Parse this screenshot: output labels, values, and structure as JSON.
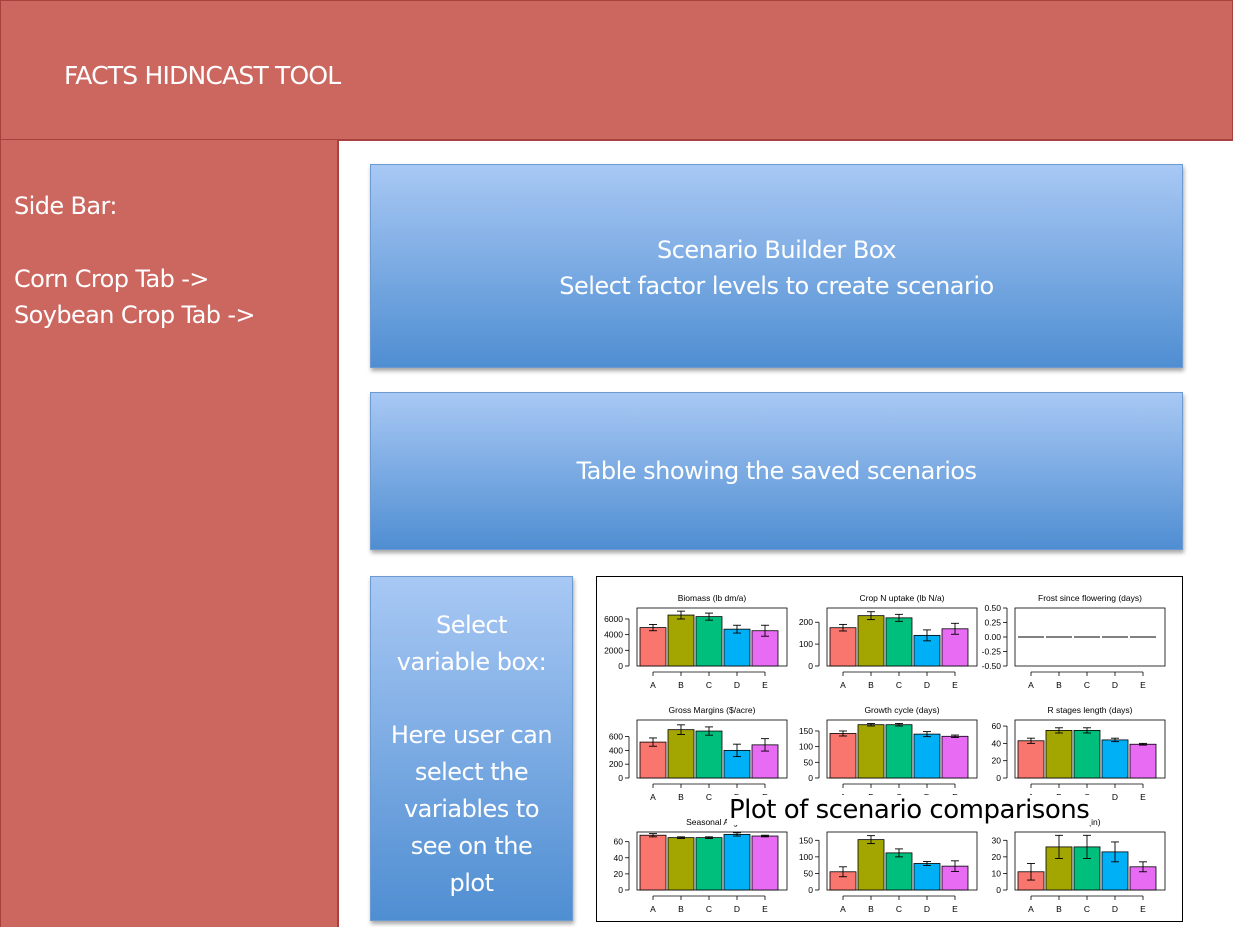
{
  "header": {
    "title": "FACTS HIDNCAST TOOL"
  },
  "sidebar": {
    "heading": "Side Bar:",
    "items": [
      {
        "label": "Corn Crop Tab ->"
      },
      {
        "label": "Soybean Crop Tab ->"
      }
    ]
  },
  "scenario_builder": {
    "title": "Scenario Builder Box",
    "subtitle": "Select factor levels to create scenario"
  },
  "saved_table": {
    "label": "Table showing the saved scenarios"
  },
  "variable_box": {
    "title_line1": "Select",
    "title_line2": "variable box:",
    "desc_lines": [
      "Here user can",
      "select the",
      "variables to",
      "see on the",
      "plot"
    ]
  },
  "plot_caption": "Plot of scenario comparisons",
  "colors": {
    "header_bg": "#cc6760",
    "box_top": "#a8c8f4",
    "box_bottom": "#4f8ed2",
    "bar_colors": [
      "#f8766d",
      "#a3a500",
      "#00bf7d",
      "#00b0f6",
      "#e76bf3"
    ]
  },
  "chart_data": [
    {
      "type": "bar",
      "title": "Biomass (lb dm/a)",
      "categories": [
        "A",
        "B",
        "C",
        "D",
        "E"
      ],
      "values": [
        4900,
        6500,
        6300,
        4700,
        4500
      ],
      "errors": [
        400,
        500,
        450,
        500,
        700
      ],
      "ylim": [
        0,
        7400
      ],
      "yticks": [
        0,
        2000,
        4000,
        6000
      ],
      "ytick_labels": [
        "0",
        "2000",
        "4000",
        "6000"
      ],
      "show_xlabels": true,
      "visible_title": "Biomass (lb dm/a)"
    },
    {
      "type": "bar",
      "title": "Crop N uptake (lb N/a)",
      "categories": [
        "A",
        "B",
        "C",
        "D",
        "E"
      ],
      "values": [
        175,
        230,
        220,
        140,
        170
      ],
      "errors": [
        15,
        18,
        16,
        25,
        25
      ],
      "ylim": [
        0,
        265
      ],
      "yticks": [
        0,
        100,
        200
      ],
      "ytick_labels": [
        "0",
        "100",
        "200"
      ],
      "show_xlabels": true,
      "visible_title": "Crop N uptake (lb N/a)"
    },
    {
      "type": "bar",
      "title": "Frost since flowering (days)",
      "categories": [
        "A",
        "B",
        "C",
        "D",
        "E"
      ],
      "values": [
        0,
        0,
        0,
        0,
        0
      ],
      "errors": [
        0,
        0,
        0,
        0,
        0
      ],
      "ylim": [
        -0.5,
        0.5
      ],
      "yticks": [
        -0.5,
        -0.25,
        0,
        0.25,
        0.5
      ],
      "ytick_labels": [
        "-0.50",
        "-0.25",
        "0.00",
        "0.25",
        "0.50"
      ],
      "show_xlabels": true,
      "visible_title": "Frost since flowering (days)"
    },
    {
      "type": "bar",
      "title": "Gross Margins ($/acre)",
      "categories": [
        "A",
        "B",
        "C",
        "D",
        "E"
      ],
      "values": [
        520,
        700,
        680,
        400,
        480
      ],
      "errors": [
        60,
        70,
        60,
        90,
        90
      ],
      "ylim": [
        0,
        840
      ],
      "yticks": [
        0,
        200,
        400,
        600
      ],
      "ytick_labels": [
        "0",
        "200",
        "400",
        "600"
      ],
      "show_xlabels": true,
      "visible_title": "Gross Margins ($/acre)"
    },
    {
      "type": "bar",
      "title": "Growth cycle (days)",
      "categories": [
        "A",
        "B",
        "C",
        "D",
        "E"
      ],
      "values": [
        142,
        170,
        170,
        140,
        133
      ],
      "errors": [
        8,
        4,
        4,
        8,
        4
      ],
      "ylim": [
        0,
        185
      ],
      "yticks": [
        0,
        50,
        100,
        150
      ],
      "ytick_labels": [
        "0",
        "50",
        "100",
        "150"
      ],
      "show_xlabels": true,
      "visible_title": "Growth cycle (days)"
    },
    {
      "type": "bar",
      "title": "R stages length (days)",
      "categories": [
        "A",
        "B",
        "C",
        "D",
        "E"
      ],
      "values": [
        43,
        55,
        55,
        44,
        39
      ],
      "errors": [
        3,
        3,
        3,
        2,
        1
      ],
      "ylim": [
        0,
        67
      ],
      "yticks": [
        0,
        20,
        40,
        60
      ],
      "ytick_labels": [
        "0",
        "20",
        "40",
        "60"
      ],
      "show_xlabels": true,
      "visible_title": "R stages length (days)"
    },
    {
      "type": "bar",
      "title": "Seasonal Avg",
      "categories": [
        "A",
        "B",
        "C",
        "D",
        "E"
      ],
      "values": [
        68,
        65,
        65,
        69,
        67
      ],
      "errors": [
        2,
        1,
        1,
        2,
        1
      ],
      "ylim": [
        0,
        72
      ],
      "yticks": [
        0,
        20,
        40,
        60
      ],
      "ytick_labels": [
        "0",
        "20",
        "40",
        "60"
      ],
      "show_xlabels": true,
      "visible_title": "Seasonal Avg"
    },
    {
      "type": "bar",
      "title": "",
      "categories": [
        "A",
        "B",
        "C",
        "D",
        "E"
      ],
      "values": [
        55,
        152,
        112,
        80,
        72
      ],
      "errors": [
        15,
        12,
        12,
        6,
        16
      ],
      "ylim": [
        0,
        175
      ],
      "yticks": [
        0,
        50,
        100,
        150
      ],
      "ytick_labels": [
        "0",
        "50",
        "100",
        "150"
      ],
      "show_xlabels": true,
      "visible_title": ""
    },
    {
      "type": "bar",
      "title": "in (in)",
      "categories": [
        "A",
        "B",
        "C",
        "D",
        "E"
      ],
      "values": [
        11,
        26,
        26,
        23,
        14
      ],
      "errors": [
        5,
        7,
        7,
        6,
        3
      ],
      "ylim": [
        0,
        35
      ],
      "yticks": [
        0,
        10,
        20,
        30
      ],
      "ytick_labels": [
        "0",
        "10",
        "20",
        "30"
      ],
      "show_xlabels": true,
      "visible_title": "in (in)"
    }
  ]
}
